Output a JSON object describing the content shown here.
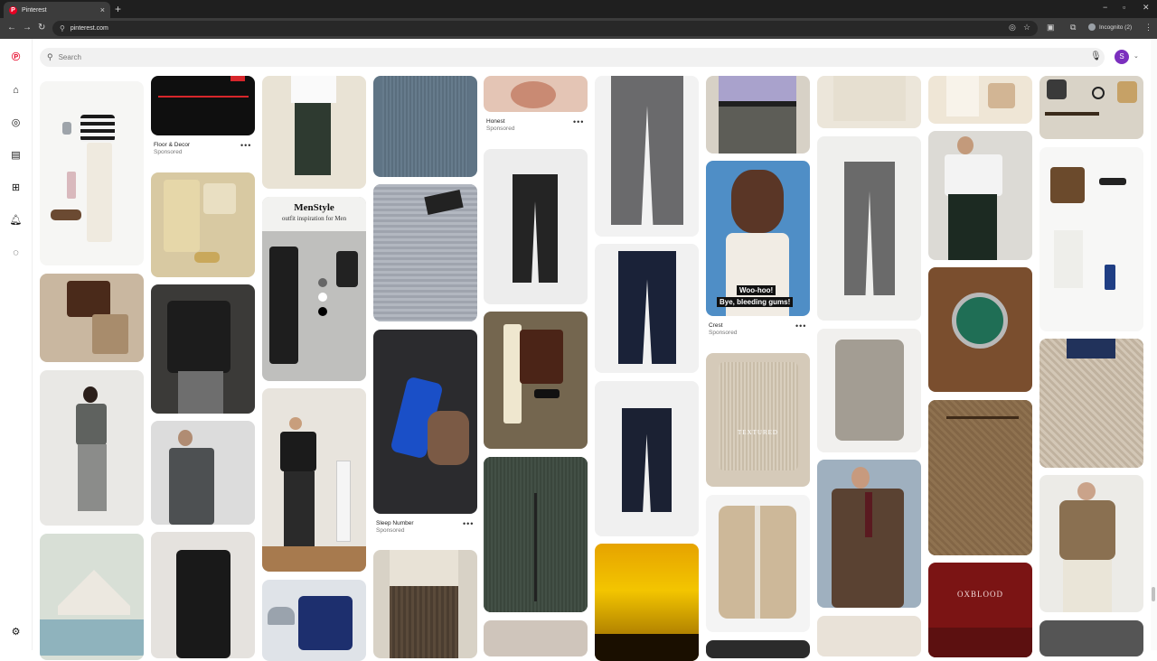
{
  "browser": {
    "tab_title": "Pinterest",
    "tab_close": "×",
    "new_tab": "+",
    "url": "pinterest.com",
    "incognito": "Incognito (2)",
    "controls": {
      "minimize": "−",
      "restore": "▫",
      "close": "✕",
      "menu": "⋮"
    }
  },
  "search": {
    "placeholder": "Search"
  },
  "profile": {
    "initial": "S"
  },
  "pins": {
    "floor_decor": {
      "title": "Floor & Decor",
      "sponsor": "Sponsored"
    },
    "honest": {
      "title": "Honest",
      "sponsor": "Sponsored"
    },
    "crest": {
      "title": "Crest",
      "sponsor": "Sponsored",
      "overlay1": "Woo-hoo!",
      "overlay2": "Bye, bleeding gums!"
    },
    "sleep_number": {
      "title": "Sleep Number",
      "sponsor": "Sponsored"
    },
    "menstyle": {
      "title": "MenStyle",
      "subtitle": "outfit inspiration for Men"
    },
    "textured": {
      "label": "TEXTURED"
    },
    "oxblood": {
      "title": "OXBLOOD"
    }
  },
  "more_label": "•••"
}
